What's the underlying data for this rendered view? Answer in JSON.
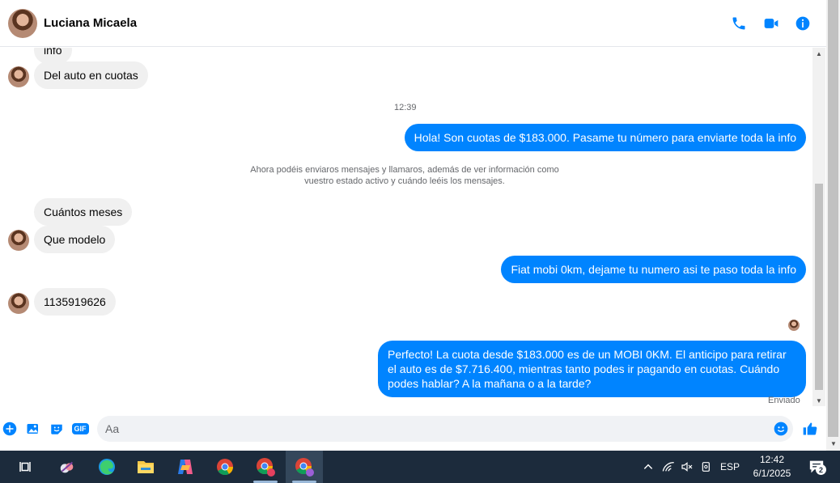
{
  "header": {
    "contact_name": "Luciana Micaela"
  },
  "colors": {
    "accent": "#0084ff",
    "incoming_bubble": "#f0f0f0",
    "taskbar": "#1c2b3c"
  },
  "messages": {
    "info_partial": "info",
    "auto_cuotas": "Del auto en cuotas",
    "time_1": "12:39",
    "out_1": "Hola! Son cuotas de $183.000. Pasame tu número para enviarte toda la info",
    "notice": "Ahora podéis enviaros mensajes y llamaros, además de ver información como vuestro estado activo y cuándo leéis los mensajes.",
    "in_meses": "Cuántos meses",
    "in_modelo": "Que modelo",
    "out_2": "Fiat mobi 0km, dejame tu numero asi te paso toda la info",
    "in_numero": "1135919626",
    "out_3": "Perfecto! La cuota desde $183.000 es de un MOBI 0KM. El anticipo para retirar el auto es de $7.716.400, mientras tanto podes ir pagando en cuotas. Cuándo podes hablar? A la mañana o a la tarde?",
    "status": "Enviado"
  },
  "composer": {
    "placeholder": "Aa",
    "gif_label": "GIF"
  },
  "taskbar": {
    "language": "ESP",
    "time": "12:42",
    "date": "6/1/2025",
    "notification_count": "2"
  }
}
